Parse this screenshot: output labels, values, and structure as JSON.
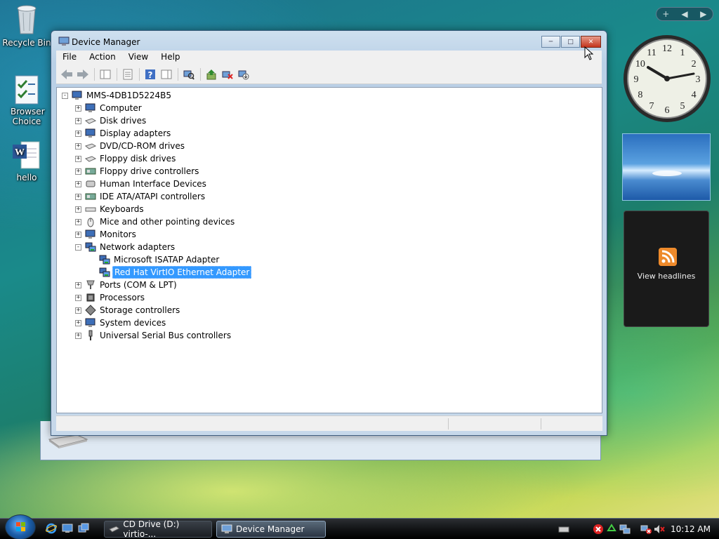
{
  "desktop": {
    "icons": [
      {
        "label": "Recycle Bin",
        "icon": "recycle-bin-icon"
      },
      {
        "label": "Browser Choice",
        "icon": "browser-choice-icon"
      },
      {
        "label": "hello",
        "icon": "word-document-icon"
      }
    ]
  },
  "window": {
    "title": "Device Manager",
    "menu": [
      "File",
      "Action",
      "View",
      "Help"
    ],
    "toolbar": [
      "back-icon",
      "forward-icon",
      "show-hide-console-tree-icon",
      "properties-icon",
      "help-icon",
      "action-pane-icon",
      "scan-hardware-icon",
      "update-driver-icon",
      "uninstall-icon",
      "disable-icon"
    ]
  },
  "tree": {
    "root": "MMS-4DB1D5224B5",
    "categories": [
      {
        "label": "Computer",
        "icon": "computer-icon",
        "expanded": false
      },
      {
        "label": "Disk drives",
        "icon": "disk-drive-icon",
        "expanded": false
      },
      {
        "label": "Display adapters",
        "icon": "display-adapter-icon",
        "expanded": false
      },
      {
        "label": "DVD/CD-ROM drives",
        "icon": "dvd-drive-icon",
        "expanded": false
      },
      {
        "label": "Floppy disk drives",
        "icon": "floppy-drive-icon",
        "expanded": false
      },
      {
        "label": "Floppy drive controllers",
        "icon": "floppy-controller-icon",
        "expanded": false
      },
      {
        "label": "Human Interface Devices",
        "icon": "hid-icon",
        "expanded": false
      },
      {
        "label": "IDE ATA/ATAPI controllers",
        "icon": "ide-controller-icon",
        "expanded": false
      },
      {
        "label": "Keyboards",
        "icon": "keyboard-icon",
        "expanded": false
      },
      {
        "label": "Mice and other pointing devices",
        "icon": "mouse-icon",
        "expanded": false
      },
      {
        "label": "Monitors",
        "icon": "monitor-icon",
        "expanded": false
      },
      {
        "label": "Network adapters",
        "icon": "network-adapter-icon",
        "expanded": true
      },
      {
        "label": "Ports (COM & LPT)",
        "icon": "port-icon",
        "expanded": false
      },
      {
        "label": "Processors",
        "icon": "processor-icon",
        "expanded": false
      },
      {
        "label": "Storage controllers",
        "icon": "storage-controller-icon",
        "expanded": false
      },
      {
        "label": "System devices",
        "icon": "system-device-icon",
        "expanded": false
      },
      {
        "label": "Universal Serial Bus controllers",
        "icon": "usb-icon",
        "expanded": false
      }
    ],
    "network_children": [
      "Microsoft ISATAP Adapter",
      "Red Hat VirtIO Ethernet Adapter"
    ],
    "selected": "Red Hat VirtIO Ethernet Adapter"
  },
  "gadgets": {
    "feed_text": "View headlines",
    "clock_numbers": [
      "12",
      "1",
      "2",
      "3",
      "4",
      "5",
      "6",
      "7",
      "8",
      "9",
      "10",
      "11"
    ]
  },
  "taskbar": {
    "tasks": [
      {
        "label": "CD Drive (D:) virtio-...",
        "active": false
      },
      {
        "label": "Device Manager",
        "active": true
      }
    ],
    "time": "10:12 AM"
  },
  "colors": {
    "selection": "#3399ff",
    "close_button": "#c4341c"
  }
}
